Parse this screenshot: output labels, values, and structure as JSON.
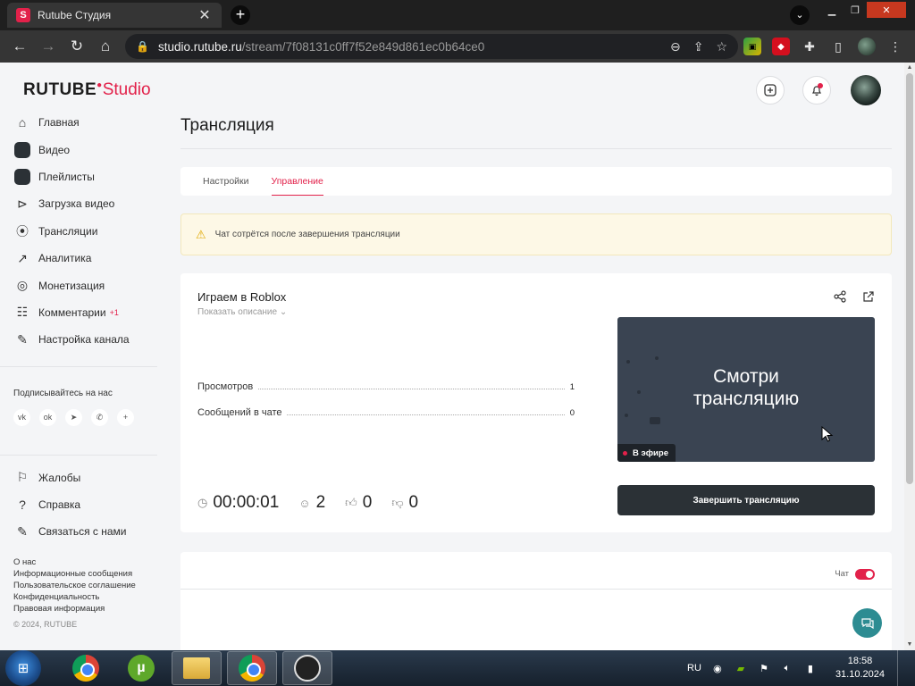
{
  "browser": {
    "tab_title": "Rutube Студия",
    "tab_favicon": "S",
    "new_tab": "+",
    "url_host": "studio.rutube.ru",
    "url_path": "/stream/7f08131c0ff7f52e849d861ec0b64ce0"
  },
  "brand": {
    "logo_main": "RUTUBE",
    "logo_studio": "Studio",
    "accent": "#e2214a"
  },
  "sidebar": {
    "items": [
      {
        "label": "Главная",
        "icon": "home-icon"
      },
      {
        "label": "Видео",
        "icon": "video-icon"
      },
      {
        "label": "Плейлисты",
        "icon": "playlist-icon"
      },
      {
        "label": "Загрузка видео",
        "icon": "upload-icon"
      },
      {
        "label": "Трансляции",
        "icon": "broadcast-icon"
      },
      {
        "label": "Аналитика",
        "icon": "analytics-icon"
      },
      {
        "label": "Монетизация",
        "icon": "monetization-icon"
      },
      {
        "label": "Комментарии",
        "icon": "comments-icon",
        "badge": "+1"
      },
      {
        "label": "Настройка канала",
        "icon": "channel-settings-icon"
      }
    ],
    "follow_title": "Подписывайтесь на нас",
    "socials": [
      "vk",
      "ok",
      "telegram",
      "viber",
      "more"
    ],
    "help_items": [
      {
        "label": "Жалобы",
        "icon": "flag-icon"
      },
      {
        "label": "Справка",
        "icon": "help-icon"
      },
      {
        "label": "Связаться с нами",
        "icon": "contact-icon"
      }
    ],
    "footer_links": [
      "О нас",
      "Информационные сообщения",
      "Пользовательское соглашение",
      "Конфиденциальность",
      "Правовая информация"
    ],
    "copyright": "© 2024, RUTUBE"
  },
  "main": {
    "page_title": "Трансляция",
    "tabs": [
      {
        "label": "Настройки",
        "active": false
      },
      {
        "label": "Управление",
        "active": true
      }
    ],
    "warning": "Чат сотрётся после завершения трансляции",
    "stream": {
      "title": "Играем в Roblox",
      "show_description": "Показать описание",
      "stats": [
        {
          "label": "Просмотров",
          "value": "1"
        },
        {
          "label": "Сообщений в чате",
          "value": "0"
        }
      ],
      "duration": "00:00:01",
      "viewers": "2",
      "likes": "0",
      "dislikes": "0",
      "player_text_line1": "Смотри",
      "player_text_line2": "трансляцию",
      "live_label": "В эфире",
      "end_button": "Завершить трансляцию"
    },
    "chat": {
      "label": "Чат",
      "enabled": true
    }
  },
  "taskbar": {
    "lang": "RU",
    "time": "18:58",
    "date": "31.10.2024"
  }
}
